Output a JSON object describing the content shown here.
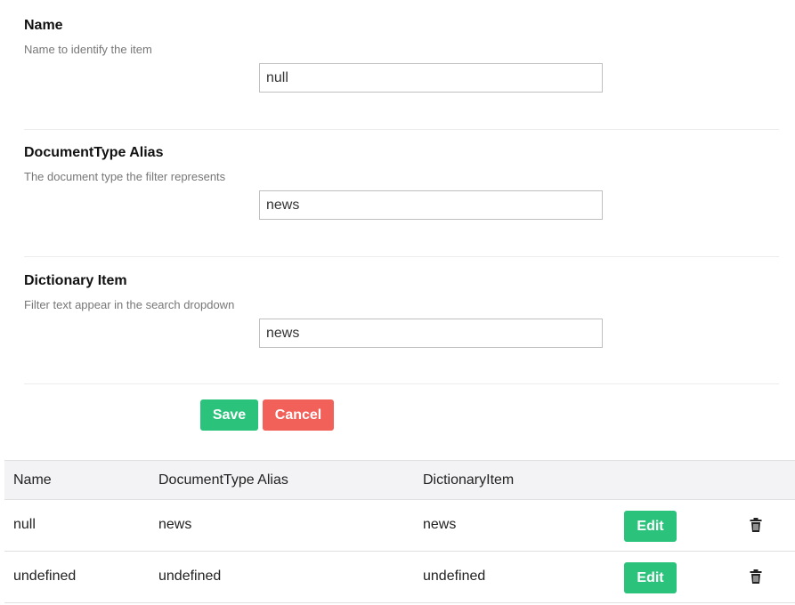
{
  "form": {
    "fields": [
      {
        "title": "Name",
        "description": "Name to identify the item",
        "value": "null"
      },
      {
        "title": "DocumentType Alias",
        "description": "The document type the filter represents",
        "value": "news"
      },
      {
        "title": "Dictionary Item",
        "description": "Filter text appear in the search dropdown",
        "value": "news"
      }
    ],
    "save_label": "Save",
    "cancel_label": "Cancel"
  },
  "table": {
    "headers": [
      "Name",
      "DocumentType Alias",
      "DictionaryItem"
    ],
    "rows": [
      {
        "name": "null",
        "alias": "news",
        "dictionary": "news",
        "edit_label": "Edit"
      },
      {
        "name": "undefined",
        "alias": "undefined",
        "dictionary": "undefined",
        "edit_label": "Edit"
      }
    ]
  },
  "colors": {
    "save": "#2bc37c",
    "cancel": "#f2605a",
    "edit": "#2bc37c"
  },
  "icons": {
    "delete": "trash-icon"
  }
}
